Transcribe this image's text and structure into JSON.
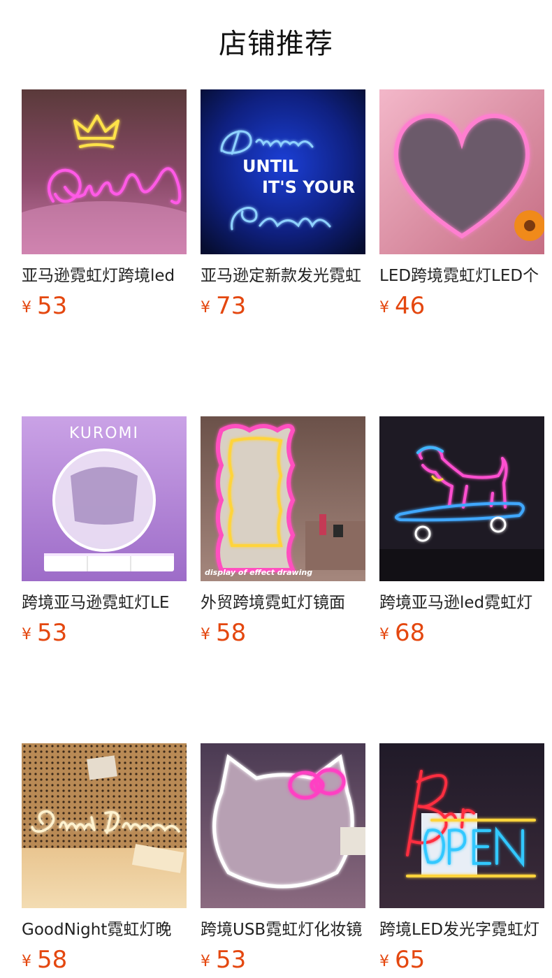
{
  "header": {
    "title": "店铺推荐"
  },
  "currency_symbol": "¥",
  "colors": {
    "price": "#e4470f"
  },
  "products": [
    {
      "name": "亚马逊霓虹灯跨境led",
      "price": "53",
      "image": "queen-neon-sign"
    },
    {
      "name": "亚马逊定新款发光霓虹",
      "price": "73",
      "image": "dream-until-its-your-reality-neon"
    },
    {
      "name": "LED跨境霓虹灯LED个",
      "price": "46",
      "image": "heart-neon-mirror"
    },
    {
      "name": "跨境亚马逊霓虹灯LE",
      "price": "53",
      "image": "kuromi-neon-mirror",
      "image_text": "KUROMI"
    },
    {
      "name": "外贸跨境霓虹灯镜面",
      "price": "58",
      "image": "wavy-neon-mirror",
      "image_text": "display of effect drawing"
    },
    {
      "name": "跨境亚马逊led霓虹灯",
      "price": "68",
      "image": "skateboard-dog-neon"
    },
    {
      "name": "GoodNight霓虹灯晚",
      "price": "58",
      "image": "sweet-dreams-neon"
    },
    {
      "name": "跨境USB霓虹灯化妆镜",
      "price": "53",
      "image": "hello-kitty-neon-mirror"
    },
    {
      "name": "跨境LED发光字霓虹灯",
      "price": "65",
      "image": "bar-open-neon"
    }
  ]
}
